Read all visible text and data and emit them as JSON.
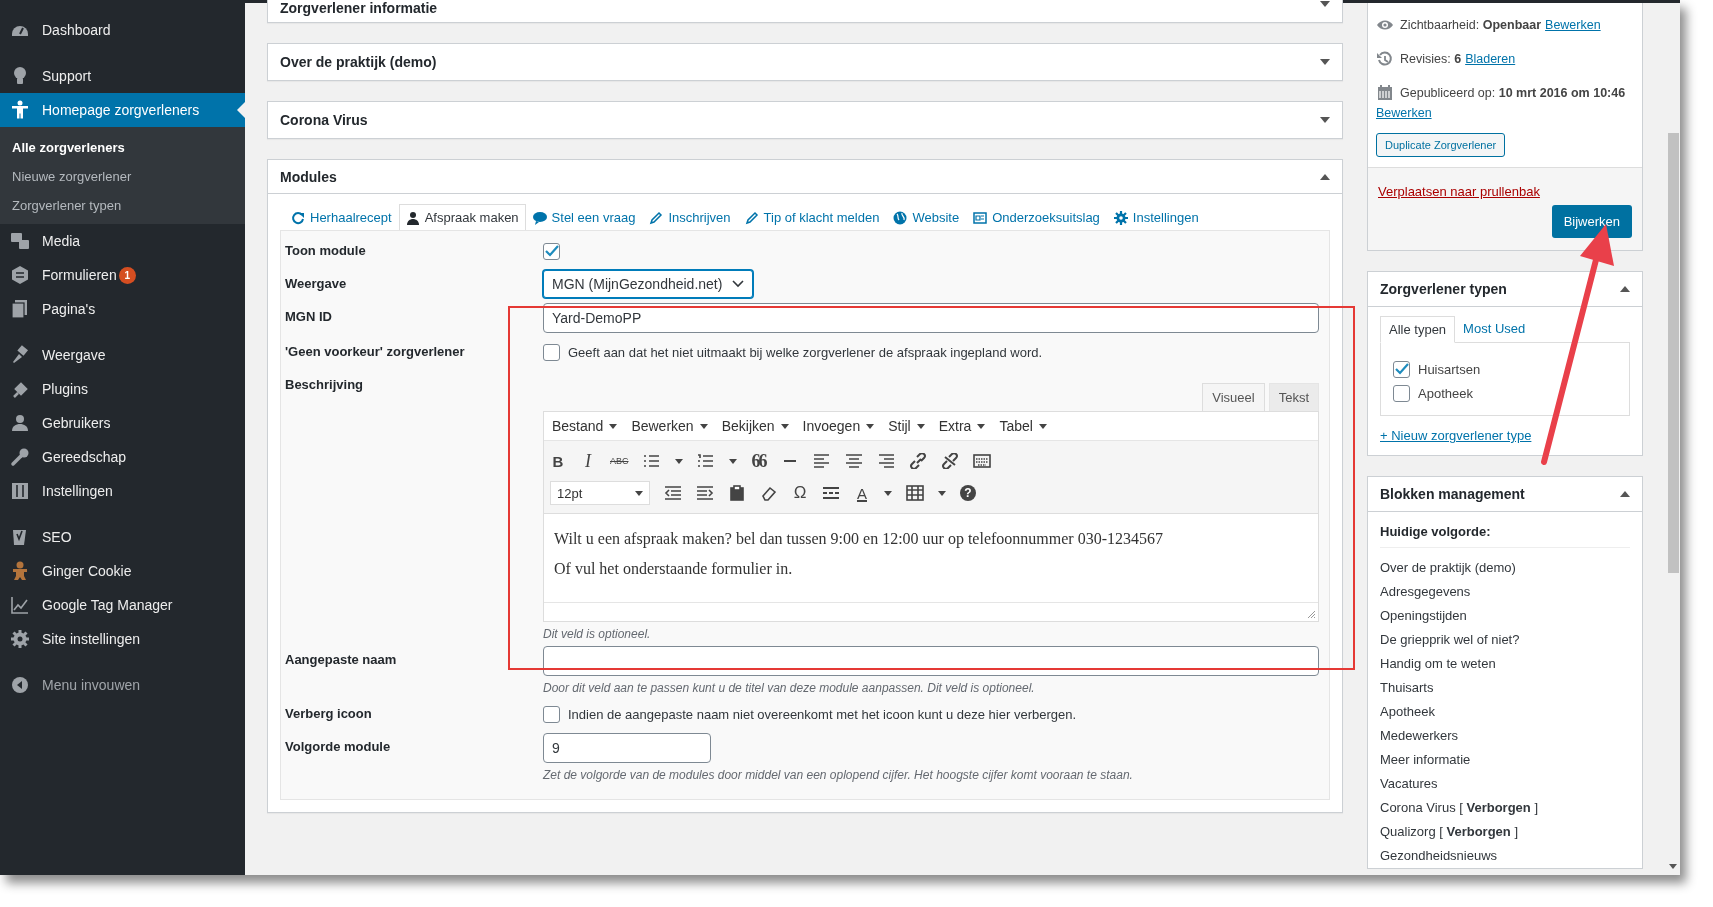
{
  "sidebar": {
    "groups": [
      [
        {
          "label": "Dashboard",
          "selected": false
        }
      ],
      [
        {
          "label": "Support",
          "selected": false
        },
        {
          "label": "Homepage zorgverleners",
          "selected": true,
          "children": [
            {
              "label": "Alle zorgverleners",
              "selected": true
            },
            {
              "label": "Nieuwe zorgverlener",
              "selected": false
            },
            {
              "label": "Zorgverlener typen",
              "selected": false
            }
          ]
        },
        {
          "label": "Media",
          "selected": false
        },
        {
          "label": "Formulieren",
          "selected": false,
          "badge": "1"
        },
        {
          "label": "Pagina's",
          "selected": false
        }
      ],
      [
        {
          "label": "Weergave",
          "selected": false
        },
        {
          "label": "Plugins",
          "selected": false
        },
        {
          "label": "Gebruikers",
          "selected": false
        },
        {
          "label": "Gereedschap",
          "selected": false
        },
        {
          "label": "Instellingen",
          "selected": false
        }
      ],
      [
        {
          "label": "SEO",
          "selected": false
        },
        {
          "label": "Ginger Cookie",
          "selected": false
        },
        {
          "label": "Google Tag Manager",
          "selected": false
        },
        {
          "label": "Site instellingen",
          "selected": false
        }
      ]
    ],
    "collapse": "Menu invouwen"
  },
  "main": {
    "panels": [
      {
        "title": "Zorgverlener informatie",
        "expanded": false
      },
      {
        "title": "Over de praktijk (demo)",
        "expanded": false
      },
      {
        "title": "Corona Virus",
        "expanded": false
      }
    ],
    "modules": {
      "title": "Modules",
      "expanded": true,
      "tabs": [
        {
          "label": "Herhaalrecept",
          "selected": false
        },
        {
          "label": "Afspraak maken",
          "selected": true
        },
        {
          "label": "Stel een vraag",
          "selected": false
        },
        {
          "label": "Inschrijven",
          "selected": false
        },
        {
          "label": "Tip of klacht melden",
          "selected": false
        },
        {
          "label": "Website",
          "selected": false
        },
        {
          "label": "Onderzoeksuitslag",
          "selected": false
        },
        {
          "label": "Instellingen",
          "selected": false
        }
      ],
      "fields": [
        {
          "kind": "checkbox",
          "label": "Toon module",
          "checked": true
        },
        {
          "kind": "select",
          "label": "Weergave",
          "value": "MGN (MijnGezondheid.net)"
        },
        {
          "kind": "text",
          "label": "MGN ID",
          "value": "Yard-DemoPP"
        },
        {
          "kind": "checkbox",
          "label": "'Geen voorkeur' zorgverlener",
          "checked": false,
          "text": "Geeft aan dat het niet uitmaakt bij welke zorgverlener de afspraak ingepland word."
        },
        {
          "kind": "editor",
          "label": "Beschrijving",
          "modes": [
            {
              "label": "Visueel",
              "selected": true
            },
            {
              "label": "Tekst",
              "selected": false
            }
          ],
          "menus": [
            "Bestand",
            "Bewerken",
            "Bekijken",
            "Invoegen",
            "Stijl",
            "Extra",
            "Tabel"
          ],
          "toolbar": [
            [
              {
                "kind": "glyph",
                "text": "B"
              },
              {
                "kind": "glyph",
                "text": "I"
              },
              {
                "kind": "glyph",
                "text": "ABC"
              },
              {
                "kind": "icon"
              },
              {
                "kind": "icon"
              },
              {
                "kind": "glyph",
                "text": "66"
              },
              {
                "kind": "icon"
              },
              {
                "kind": "icon"
              },
              {
                "kind": "icon"
              },
              {
                "kind": "icon"
              },
              {
                "kind": "icon"
              },
              {
                "kind": "icon"
              },
              {
                "kind": "icon"
              }
            ],
            [
              {
                "kind": "select",
                "text": "12pt"
              },
              {
                "kind": "icon"
              },
              {
                "kind": "icon"
              },
              {
                "kind": "icon"
              },
              {
                "kind": "icon"
              },
              {
                "kind": "glyph",
                "text": "Ω"
              },
              {
                "kind": "icon"
              },
              {
                "kind": "glyph",
                "text": "A"
              },
              {
                "kind": "icon"
              },
              {
                "kind": "glyph",
                "text": "?"
              }
            ]
          ],
          "paragraphs": [
            "Wilt u een afspraak maken? bel dan tussen 9:00 en 12:00 uur op telefoonnummer 030-1234567",
            "Of vul het onderstaande formulier in."
          ],
          "hint": "Dit veld is optioneel."
        },
        {
          "kind": "text",
          "label": "Aangepaste naam",
          "hint": "Door dit veld aan te passen kunt u de titel van deze module aanpassen. Dit veld is optioneel."
        },
        {
          "kind": "checkbox",
          "label": "Verberg icoon",
          "checked": false,
          "text": "Indien de aangepaste naam niet overeenkomt met het icoon kunt u deze hier verbergen."
        },
        {
          "kind": "number",
          "label": "Volgorde module",
          "value": "9",
          "hint": "Zet de volgorde van de modules door middel van een oplopend cijfer. Het hoogste cijfer komt vooraan te staan."
        }
      ]
    }
  },
  "publish": {
    "rows": [
      {
        "text": "Zichtbaarheid: **Openbaar**",
        "link": "Bewerken"
      },
      {
        "text": "Revisies: **6**",
        "link": "Bladeren"
      },
      {
        "text": "Gepubliceerd op: **10 mrt 2016 om 10:46**",
        "link": "Bewerken"
      }
    ],
    "duplicate_button": "Duplicate Zorgverlener",
    "trash_link": "Verplaatsen naar prullenbak",
    "update_button": "Bijwerken"
  },
  "types_box": {
    "title": "Zorgverlener typen",
    "expanded": true,
    "tabs": [
      {
        "label": "Alle typen",
        "selected": true
      },
      {
        "label": "Most Used",
        "selected": false
      }
    ],
    "items": [
      {
        "label": "Huisartsen",
        "checked": true
      },
      {
        "label": "Apotheek",
        "checked": false
      }
    ],
    "add_link": "+ Nieuw zorgverlener type"
  },
  "blocks_box": {
    "title": "Blokken management",
    "expanded": true,
    "heading": "Huidige volgorde:",
    "items": [
      "Over de praktijk (demo)",
      "Adresgegevens",
      "Openingstijden",
      "De griepprik wel of niet?",
      "Handig om te weten",
      "Thuisarts",
      "Apotheek",
      "Medewerkers",
      "Meer informatie",
      "Vacatures",
      "Corona Virus [ **Verborgen** ]",
      "Qualizorg [ **Verborgen** ]",
      "Gezondheidsnieuws"
    ]
  }
}
